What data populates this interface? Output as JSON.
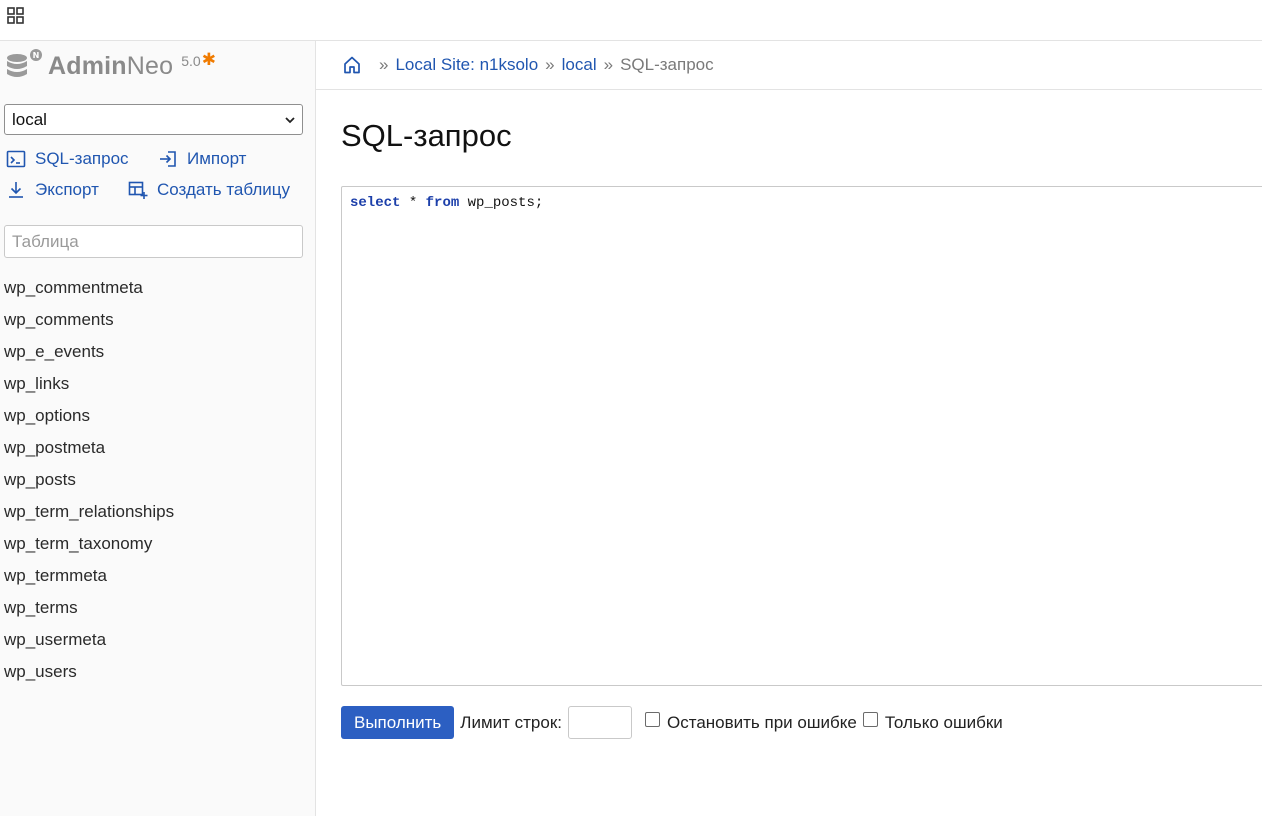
{
  "app": {
    "brand_bold": "Admin",
    "brand_light": "Neo",
    "version": "5.0",
    "version_mark": "✱",
    "accent_color": "#2056b0",
    "star_color": "#f07b00"
  },
  "sidebar": {
    "db_select_value": "local",
    "actions": {
      "sql_query": "SQL-запрос",
      "import": "Импорт",
      "export": "Экспорт",
      "create_table": "Создать таблицу"
    },
    "filter_placeholder": "Таблица",
    "tables": [
      "wp_commentmeta",
      "wp_comments",
      "wp_e_events",
      "wp_links",
      "wp_options",
      "wp_postmeta",
      "wp_posts",
      "wp_term_relationships",
      "wp_term_taxonomy",
      "wp_termmeta",
      "wp_terms",
      "wp_usermeta",
      "wp_users"
    ]
  },
  "breadcrumb": {
    "server": "Local Site: n1ksolo",
    "database": "local",
    "current": "SQL-запрос",
    "separator": "»"
  },
  "main": {
    "title": "SQL-запрос",
    "query": {
      "kw1": "select",
      "part1": " * ",
      "kw2": "from",
      "part2": " wp_posts;"
    },
    "run_button": "Выполнить",
    "limit_label": "Лимит строк:",
    "limit_value": "",
    "stop_on_error": "Остановить при ошибке",
    "only_errors": "Только ошибки"
  }
}
